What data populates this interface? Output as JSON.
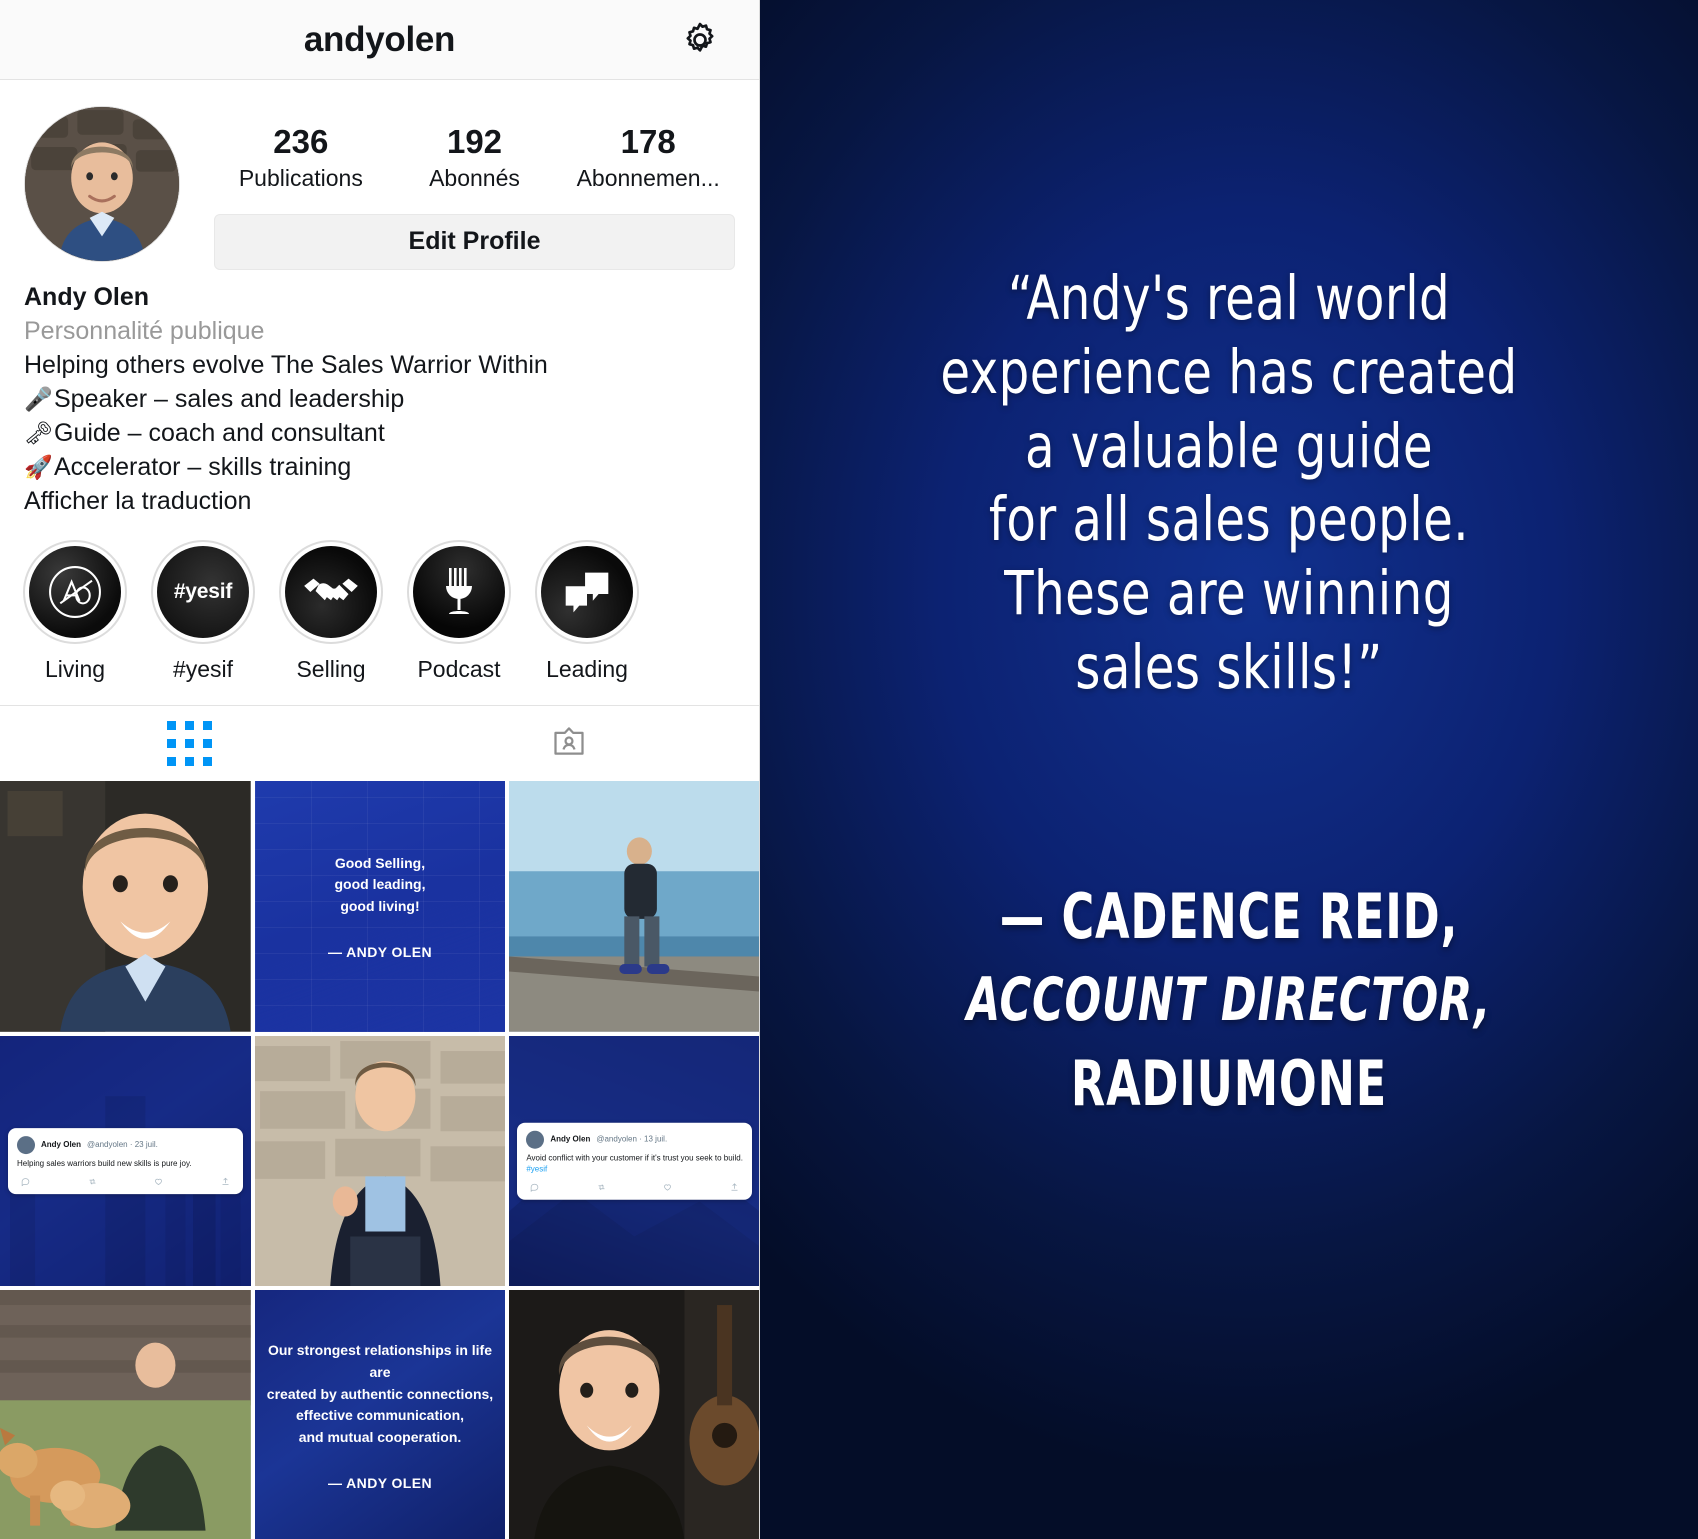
{
  "profile": {
    "header": {
      "username": "andyolen",
      "settings_icon": "gear-icon"
    },
    "stats": [
      {
        "count": "236",
        "label": "Publications"
      },
      {
        "count": "192",
        "label": "Abonnés"
      },
      {
        "count": "178",
        "label": "Abonnemen..."
      }
    ],
    "edit_button": "Edit Profile",
    "bio": {
      "name": "Andy Olen",
      "category": "Personnalité publique",
      "line1": "Helping others evolve The Sales Warrior Within",
      "line2_emoji": "🎤",
      "line2": "Speaker – sales and leadership",
      "line3_emoji": "🗝",
      "line3": "Guide – coach and consultant",
      "line4_emoji": "🚀",
      "line4": "Accelerator – skills training",
      "translate": "Afficher la traduction"
    },
    "highlights": [
      {
        "label": "Living",
        "icon": "ao-monogram-icon"
      },
      {
        "label": "#yesif",
        "icon": "yesif-text-icon",
        "text": "#yesif"
      },
      {
        "label": "Selling",
        "icon": "handshake-icon"
      },
      {
        "label": "Podcast",
        "icon": "microphone-icon"
      },
      {
        "label": "Leading",
        "icon": "speech-bubbles-icon"
      }
    ],
    "tabs": [
      {
        "name": "grid-tab",
        "icon": "grid-icon",
        "active": true
      },
      {
        "name": "tagged-tab",
        "icon": "tagged-person-icon",
        "active": false
      }
    ],
    "grid": [
      {
        "kind": "photo",
        "desc": "portrait-smiling-man-suit"
      },
      {
        "kind": "quote",
        "text": "Good Selling,\ngood leading,\ngood living!",
        "attrib": "— ANDY OLEN",
        "style": "brick"
      },
      {
        "kind": "photo",
        "desc": "man-at-lakeshore"
      },
      {
        "kind": "tweet",
        "author": "Andy Olen",
        "handle": "@andyolen · 23 juil.",
        "text": "Helping sales warriors build new skills is pure joy.",
        "hashtag": ""
      },
      {
        "kind": "photo",
        "desc": "man-seated-stone-wall"
      },
      {
        "kind": "tweet",
        "author": "Andy Olen",
        "handle": "@andyolen · 13 juil.",
        "text": "Avoid conflict with your customer if it's trust you seek to build.",
        "hashtag": "#yesif"
      },
      {
        "kind": "photo",
        "desc": "man-with-dogs-in-yard"
      },
      {
        "kind": "quote",
        "text": "Our strongest relationships in life are\ncreated by authentic connections,\neffective communication,\nand mutual cooperation.",
        "attrib": "— ANDY OLEN",
        "style": "navy"
      },
      {
        "kind": "photo",
        "desc": "man-with-guitar"
      }
    ]
  },
  "quote_card": {
    "lines": [
      "“Andy's real world",
      "experience has created",
      "a valuable guide",
      "for all sales people.",
      "These are winning",
      "sales skills!”"
    ],
    "attribution_name": "— CADENCE REID,",
    "attribution_title": "ACCOUNT DIRECTOR,",
    "attribution_company": "RADIUMONE",
    "background_color": "#0c2272",
    "text_color": "#ffffff"
  }
}
